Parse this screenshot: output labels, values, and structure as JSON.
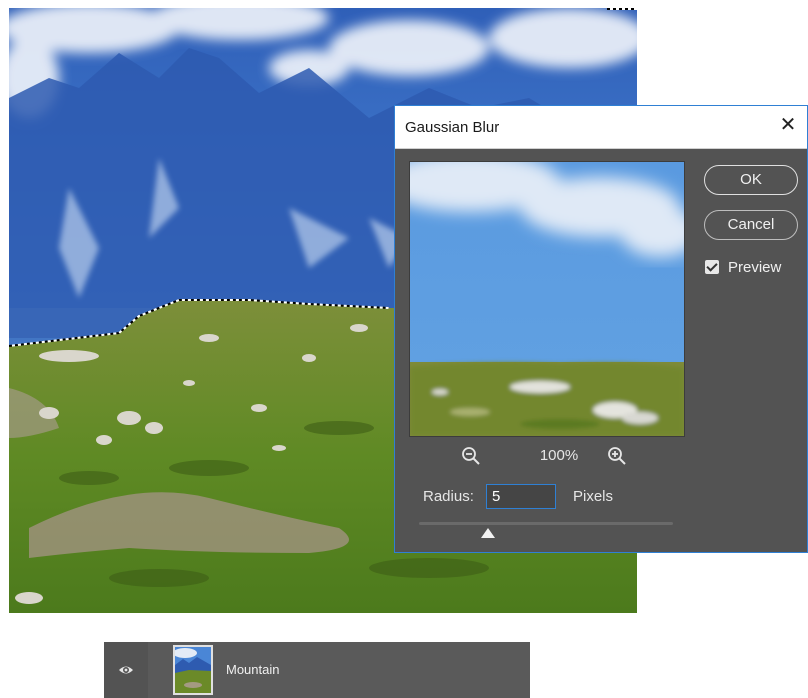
{
  "dialog": {
    "title": "Gaussian Blur",
    "ok_label": "OK",
    "cancel_label": "Cancel",
    "preview_label": "Preview",
    "preview_checked": true,
    "zoom_level": "100%",
    "radius_label": "Radius:",
    "radius_value": "5",
    "radius_unit": "Pixels",
    "radius_slider_fraction": 0.27
  },
  "icons": {
    "close": "close-icon",
    "zoom_out": "zoom-out-icon",
    "zoom_in": "zoom-in-icon",
    "visibility": "eye-icon",
    "preview_check": "checkbox-icon"
  },
  "layers": [
    {
      "name": "Mountain",
      "visible": true
    }
  ],
  "colors": {
    "dialog_bg": "#535353",
    "accent": "#2f80d4",
    "sky": "#3b6fc4",
    "grass": "#6f8a2a"
  }
}
